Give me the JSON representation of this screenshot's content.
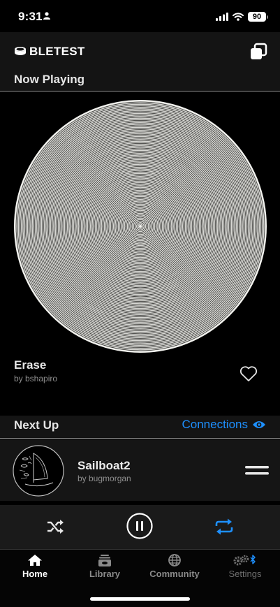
{
  "status_bar": {
    "time": "9:31",
    "battery": "90"
  },
  "app": {
    "title": "BLETEST"
  },
  "now_playing": {
    "section_title": "Now Playing",
    "track_title": "Erase",
    "track_author": "by bshapiro"
  },
  "next_up": {
    "section_title": "Next Up",
    "connections_label": "Connections",
    "items": [
      {
        "title": "Sailboat2",
        "author": "by bugmorgan"
      }
    ]
  },
  "tabs": [
    {
      "label": "Home",
      "icon": "home-icon",
      "active": true
    },
    {
      "label": "Library",
      "icon": "library-icon",
      "active": false
    },
    {
      "label": "Community",
      "icon": "globe-icon",
      "active": false
    },
    {
      "label": "Settings",
      "icon": "gears-bluetooth-icon",
      "active": false
    }
  ],
  "colors": {
    "accent": "#1e90ff",
    "background": "#000000",
    "header": "#141414",
    "muted_text": "#8e8e8e"
  }
}
